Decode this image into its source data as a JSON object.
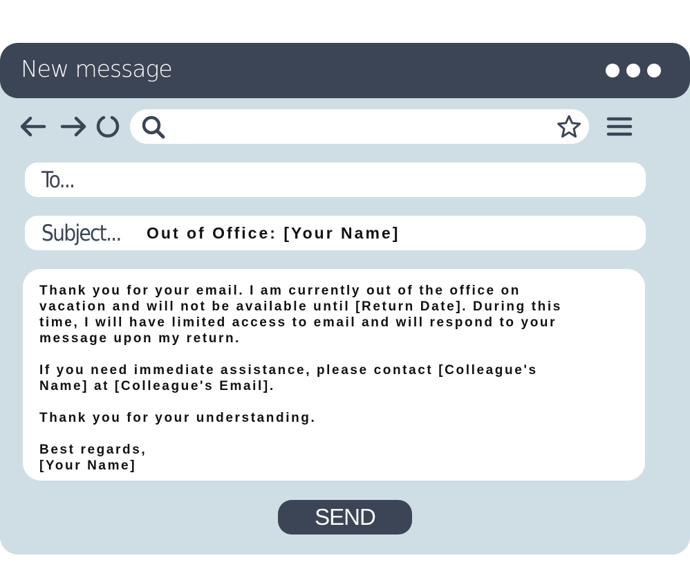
{
  "window": {
    "title": "New message",
    "menu_dots_icon": "more-dots-icon"
  },
  "toolbar": {
    "back_icon": "arrow-left-icon",
    "forward_icon": "arrow-right-icon",
    "reload_icon": "reload-icon",
    "search_icon": "search-icon",
    "search_value": "",
    "bookmark_icon": "star-icon",
    "menu_icon": "hamburger-menu-icon"
  },
  "compose": {
    "to_label": "To...",
    "to_value": "",
    "subject_label": "Subject...",
    "subject_value": "Out of Office: [Your Name]",
    "body": "Thank you for your email. I am currently out of the office on\nvacation and will not be available until [Return Date]. During this\ntime, I will have limited access to email and will respond to your\nmessage upon my return.\n\nIf you need immediate assistance, please contact [Colleague's\nName] at [Colleague's Email].\n\nThank you for your understanding.\n\nBest regards,\n[Your Name]",
    "send_label": "SEND"
  },
  "colors": {
    "titlebar": "#3c4556",
    "window_bg": "#cfdee5",
    "field_bg": "#ffffff",
    "send_button": "#3c4556"
  }
}
